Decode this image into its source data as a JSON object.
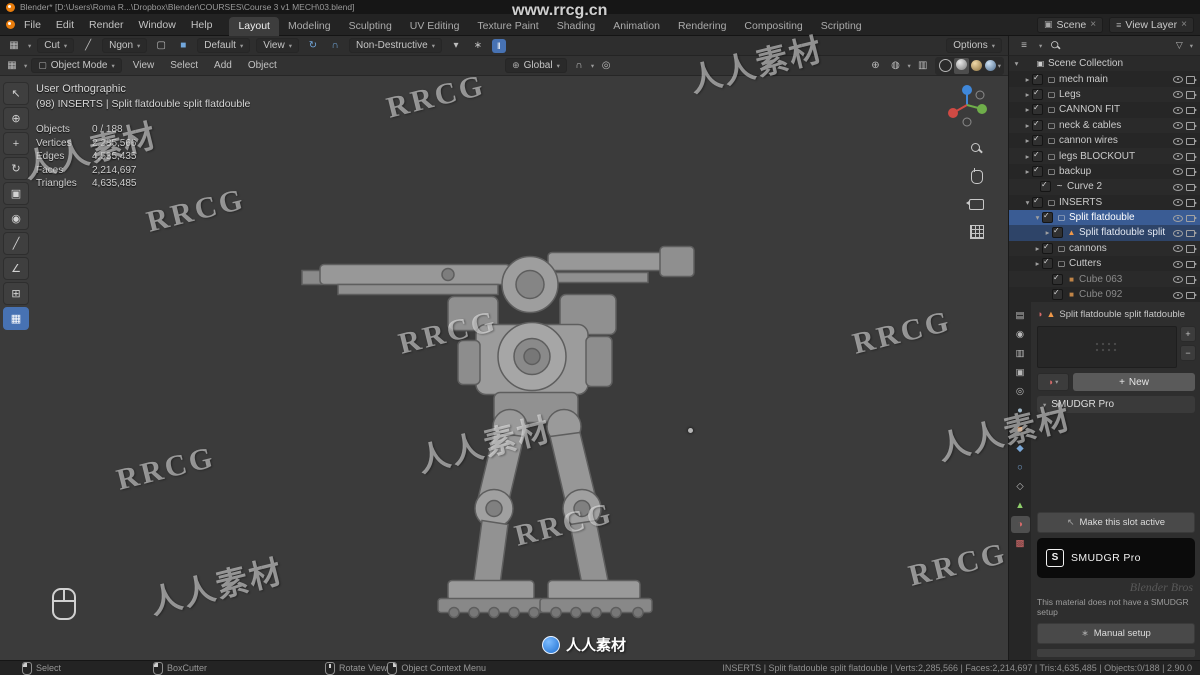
{
  "window": {
    "title": "Blender* [D:\\Users\\Roma R...\\Dropbox\\Blender\\COURSES\\Course 3 v1 MECH\\03.blend]"
  },
  "topbar": {
    "menus": [
      "File",
      "Edit",
      "Render",
      "Window",
      "Help"
    ],
    "tabs": [
      {
        "label": "Layout",
        "cls": "active"
      },
      {
        "label": "Modeling",
        "cls": ""
      },
      {
        "label": "Sculpting",
        "cls": ""
      },
      {
        "label": "UV Editing",
        "cls": ""
      },
      {
        "label": "Texture Paint",
        "cls": ""
      },
      {
        "label": "Shading",
        "cls": ""
      },
      {
        "label": "Animation",
        "cls": ""
      },
      {
        "label": "Rendering",
        "cls": ""
      },
      {
        "label": "Compositing",
        "cls": ""
      },
      {
        "label": "Scripting",
        "cls": ""
      }
    ],
    "scene": "Scene",
    "view_layer": "View Layer"
  },
  "tool_settings": {
    "tool_label": "Cut",
    "ngon": "Ngon",
    "preset": "Default",
    "view": "View",
    "mode": "Non-Destructive",
    "pause": "‖",
    "options": "Options"
  },
  "viewport_header": {
    "mode": "Object Mode",
    "menus": [
      "View",
      "Select",
      "Add",
      "Object"
    ],
    "orientation": "Global"
  },
  "toolbar": {
    "tools": [
      {
        "name": "select-tweak-tool",
        "glyph": "↖",
        "cls": ""
      },
      {
        "name": "cursor-tool",
        "glyph": "⊕",
        "cls": ""
      },
      {
        "name": "move-tool",
        "glyph": "+",
        "cls": ""
      },
      {
        "name": "rotate-tool",
        "glyph": "↻",
        "cls": ""
      },
      {
        "name": "scale-tool",
        "glyph": "▣",
        "cls": ""
      },
      {
        "name": "transform-tool",
        "glyph": "◉",
        "cls": ""
      },
      {
        "name": "annotate-tool",
        "glyph": "╱",
        "cls": ""
      },
      {
        "name": "measure-tool",
        "glyph": "∠",
        "cls": ""
      },
      {
        "name": "add-cube-tool",
        "glyph": "⊞",
        "cls": ""
      },
      {
        "name": "boxcutter-tool",
        "glyph": "▦",
        "cls": "active"
      }
    ]
  },
  "viewport": {
    "view_label": "User Orthographic",
    "context_label": "(98) INSERTS | Split flatdouble split flatdouble",
    "stats": [
      {
        "label": "Objects",
        "value": "0 / 188"
      },
      {
        "label": "Vertices",
        "value": "2,285,566"
      },
      {
        "label": "Edges",
        "value": "4,535,435"
      },
      {
        "label": "Faces",
        "value": "2,214,697"
      },
      {
        "label": "Triangles",
        "value": "4,635,485"
      }
    ]
  },
  "outliner": {
    "items": [
      {
        "label": "Scene Collection",
        "pad": "3px",
        "arrow": "▾",
        "icon": "ic-scene",
        "cls": "root"
      },
      {
        "label": "mech main",
        "pad": "14px",
        "arrow": "▸",
        "icon": "ic-coll",
        "cls": ""
      },
      {
        "label": "Legs",
        "pad": "14px",
        "arrow": "▸",
        "icon": "ic-coll",
        "cls": ""
      },
      {
        "label": "CANNON FIT",
        "pad": "14px",
        "arrow": "▸",
        "icon": "ic-coll",
        "cls": ""
      },
      {
        "label": "neck & cables",
        "pad": "14px",
        "arrow": "▸",
        "icon": "ic-coll",
        "cls": ""
      },
      {
        "label": "cannon wires",
        "pad": "14px",
        "arrow": "▸",
        "icon": "ic-coll",
        "cls": ""
      },
      {
        "label": "legs BLOCKOUT",
        "pad": "14px",
        "arrow": "▸",
        "icon": "ic-coll",
        "cls": ""
      },
      {
        "label": "backup",
        "pad": "14px",
        "arrow": "▸",
        "icon": "ic-coll",
        "cls": ""
      },
      {
        "label": "Curve 2",
        "pad": "22px",
        "arrow": "",
        "icon": "ic-curve",
        "cls": ""
      },
      {
        "label": "INSERTS",
        "pad": "14px",
        "arrow": "▾",
        "icon": "ic-coll",
        "cls": ""
      },
      {
        "label": "Split flatdouble",
        "pad": "24px",
        "arrow": "▾",
        "icon": "ic-coll",
        "cls": "sel"
      },
      {
        "label": "Split flatdouble split",
        "pad": "34px",
        "arrow": "▸",
        "icon": "ic-mesh",
        "cls": "sel2"
      },
      {
        "label": "cannons",
        "pad": "24px",
        "arrow": "▸",
        "icon": "ic-coll",
        "cls": ""
      },
      {
        "label": "Cutters",
        "pad": "24px",
        "arrow": "▸",
        "icon": "ic-coll",
        "cls": ""
      },
      {
        "label": "Cube 063",
        "pad": "34px",
        "arrow": "",
        "icon": "ic-cube",
        "cls": "dim"
      },
      {
        "label": "Cube 092",
        "pad": "34px",
        "arrow": "",
        "icon": "ic-cube",
        "cls": "dim"
      }
    ]
  },
  "properties": {
    "tabs": [
      {
        "name": "tool-tab",
        "glyph": "▤",
        "color": "#b8b8b8",
        "cls": ""
      },
      {
        "name": "render-tab",
        "glyph": "◉",
        "color": "#b8b8b8",
        "cls": ""
      },
      {
        "name": "output-tab",
        "glyph": "▥",
        "color": "#b8b8b8",
        "cls": ""
      },
      {
        "name": "view-layer-tab",
        "glyph": "▣",
        "color": "#b8b8b8",
        "cls": ""
      },
      {
        "name": "scene-tab",
        "glyph": "◎",
        "color": "#b8b8b8",
        "cls": ""
      },
      {
        "name": "world-tab",
        "glyph": "●",
        "color": "#9fb7c8",
        "cls": ""
      },
      {
        "name": "object-tab",
        "glyph": "■",
        "color": "#e08b45",
        "cls": ""
      },
      {
        "name": "modifiers-tab",
        "glyph": "◆",
        "color": "#7aa8d8",
        "cls": ""
      },
      {
        "name": "physics-tab",
        "glyph": "○",
        "color": "#7aa8d8",
        "cls": ""
      },
      {
        "name": "constraints-tab",
        "glyph": "◇",
        "color": "#b8b8b8",
        "cls": ""
      },
      {
        "name": "object-data-tab",
        "glyph": "▲",
        "color": "#8fce6b",
        "cls": ""
      },
      {
        "name": "material-tab",
        "glyph": "◑",
        "color": "#d46a6a",
        "cls": "active"
      },
      {
        "name": "texture-tab",
        "glyph": "▩",
        "color": "#d46a6a",
        "cls": ""
      }
    ],
    "breadcrumb": "Split flatdouble split flatdouble",
    "new_label": "New",
    "plus": "+",
    "minus": "−",
    "panel_title": "SMUDGR Pro",
    "make_slot_label": "Make this slot active",
    "brand_letter": "S",
    "brand": "SMUDGR Pro",
    "ghost": "Blender Bros",
    "note": "This material does not have a SMUDGR setup",
    "manual_label": "Manual setup"
  },
  "status_bar": {
    "items": [
      {
        "label": "Select",
        "icon": "m-left"
      },
      {
        "label": "BoxCutter",
        "icon": "m-left"
      },
      {
        "label": "Rotate View",
        "icon": "m-mid"
      },
      {
        "label": "Object Context Menu",
        "icon": "m-right"
      }
    ],
    "stats": "INSERTS | Split flatdouble split flatdouble | Verts:2,285,566 | Faces:2,214,697 | Tris:4,635,485 | Objects:0/188 | 2.90.0"
  },
  "watermarks": {
    "cn": "人人素材",
    "en": "RRCG",
    "url": "www.rrcg.cn"
  },
  "colors": {
    "accent": "#4772b3",
    "selection": "#3a5c94",
    "object_orange": "#e08b45",
    "mesh_orange": "#ef9849"
  }
}
